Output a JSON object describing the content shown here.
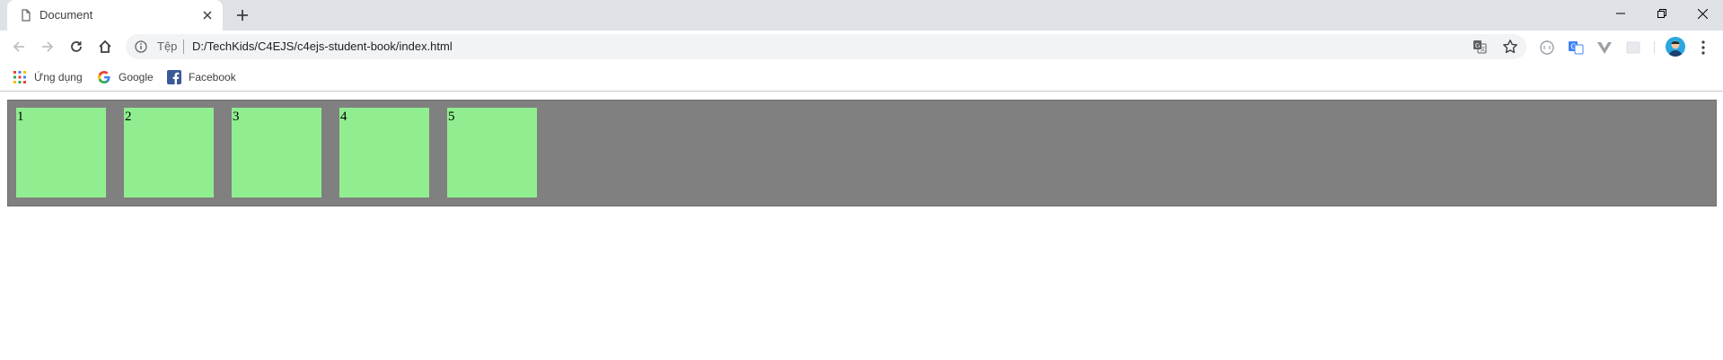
{
  "tab": {
    "title": "Document",
    "favicon": "page-icon"
  },
  "toolbar": {
    "site_label": "Tệp",
    "url": "D:/TechKids/C4EJS/c4ejs-student-book/index.html"
  },
  "bookmarks": [
    {
      "label": "Ứng dụng",
      "icon": "apps-grid-icon"
    },
    {
      "label": "Google",
      "icon": "google-icon"
    },
    {
      "label": "Facebook",
      "icon": "facebook-icon"
    }
  ],
  "page": {
    "boxes": [
      "1",
      "2",
      "3",
      "4",
      "5"
    ]
  },
  "colors": {
    "container_bg": "#808080",
    "box_bg": "#90ee90",
    "tabstrip_bg": "#dee1e6",
    "omnibox_bg": "#f1f3f4"
  }
}
